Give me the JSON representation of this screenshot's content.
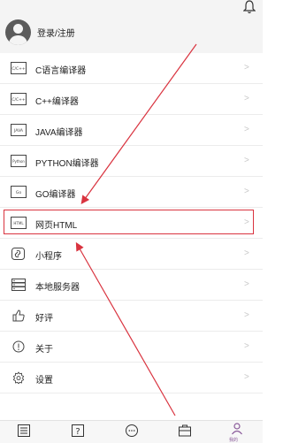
{
  "header": {
    "login_label": "登录/注册"
  },
  "menu": {
    "items": [
      {
        "label": "C语言编译器",
        "icon": "c-file-icon",
        "icon_text": "C/C++"
      },
      {
        "label": "C++编译器",
        "icon": "cpp-file-icon",
        "icon_text": "C/C++"
      },
      {
        "label": "JAVA编译器",
        "icon": "java-file-icon",
        "icon_text": "JAVA"
      },
      {
        "label": "PYTHON编译器",
        "icon": "python-file-icon",
        "icon_text": "Python"
      },
      {
        "label": "GO编译器",
        "icon": "go-file-icon",
        "icon_text": "Go"
      },
      {
        "label": "网页HTML",
        "icon": "html-file-icon",
        "icon_text": "HTML"
      },
      {
        "label": "小程序",
        "icon": "link-icon"
      },
      {
        "label": "本地服务器",
        "icon": "server-icon"
      },
      {
        "label": "好评",
        "icon": "thumbs-up-icon"
      },
      {
        "label": "关于",
        "icon": "info-icon"
      },
      {
        "label": "设置",
        "icon": "gear-icon"
      }
    ],
    "chevron": ">"
  },
  "tabbar": {
    "items": [
      {
        "icon": "sliders-icon"
      },
      {
        "icon": "help-icon"
      },
      {
        "icon": "chat-icon"
      },
      {
        "icon": "briefcase-icon"
      },
      {
        "icon": "profile-icon",
        "active": true,
        "label": "我的"
      }
    ]
  },
  "colors": {
    "highlight": "#d9333f",
    "active_tab": "#8a5a9a",
    "header_bg": "#f4f4f4"
  }
}
